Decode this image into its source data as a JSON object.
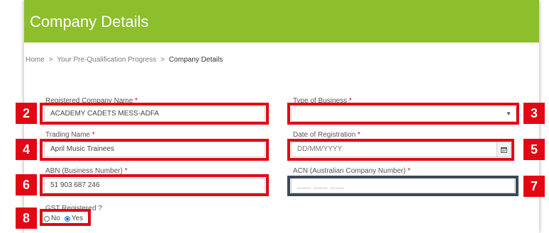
{
  "header": {
    "title": "Company Details",
    "color": "#8dbe2c"
  },
  "breadcrumb": {
    "items": [
      "Home",
      "Your Pre-Qualification Progress"
    ],
    "separator": ">",
    "current": "Company Details"
  },
  "form": {
    "company_name": {
      "label": "Registered Company Name",
      "required": "*",
      "value": "ACADEMY CADETS MESS-ADFA"
    },
    "business_type": {
      "label": "Type of Business",
      "required": "*",
      "value": "",
      "icon": "chevron-down-icon"
    },
    "trading_name": {
      "label": "Trading Name",
      "required": "*",
      "value": "April Music Trainees"
    },
    "registration_date": {
      "label": "Date of Registration",
      "required": "*",
      "placeholder": "DD/MM/YYYY",
      "icon": "calendar-icon"
    },
    "abn": {
      "label": "ABN (Business Number)",
      "required": "*",
      "value": "51 903 687 246"
    },
    "acn": {
      "label": "ACN (Australian Company Number)",
      "required": "*",
      "placeholder": "___ ___ ___"
    },
    "gst": {
      "label": "GST Registered ?",
      "options": [
        "No",
        "Yes"
      ],
      "selected": "Yes"
    }
  },
  "annotations": {
    "badges": [
      "2",
      "3",
      "4",
      "5",
      "6",
      "7",
      "8"
    ],
    "highlight_color": "#e30613",
    "focus_color": "#3b4a58"
  }
}
